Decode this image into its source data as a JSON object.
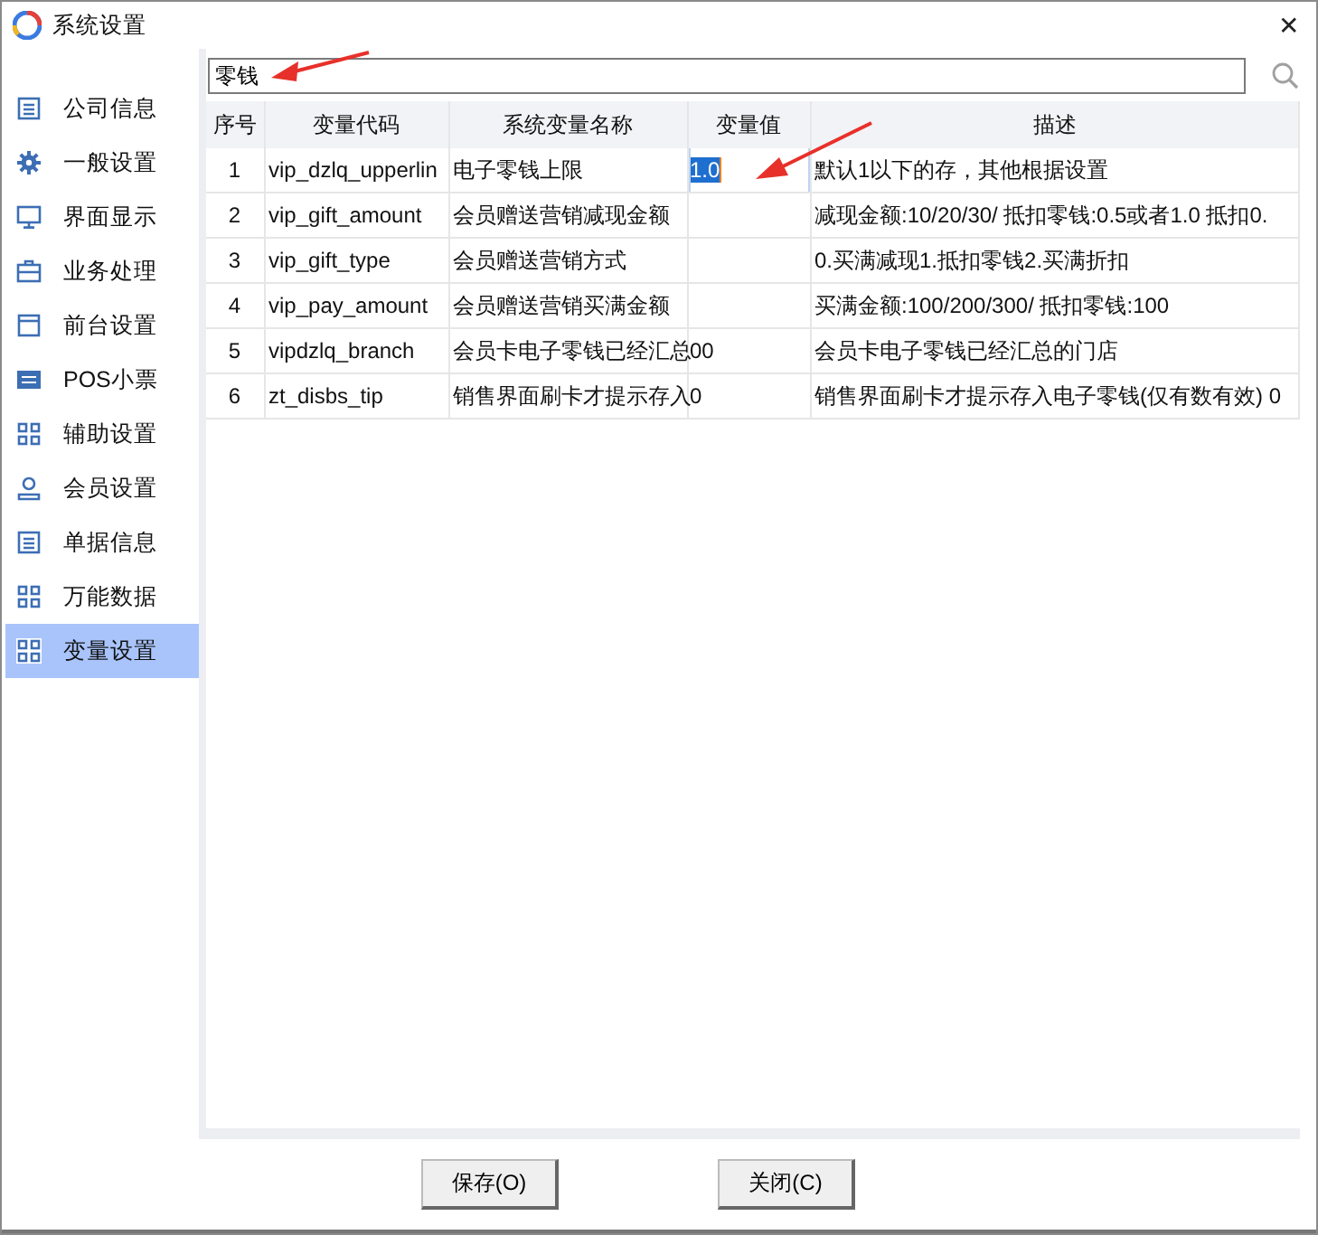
{
  "window": {
    "title": "系统设置",
    "close": "✕"
  },
  "sidebar": {
    "items": [
      {
        "label": "公司信息",
        "kind": "doc",
        "selected": false
      },
      {
        "label": "一般设置",
        "kind": "gear",
        "selected": false
      },
      {
        "label": "界面显示",
        "kind": "monitor",
        "selected": false
      },
      {
        "label": "业务处理",
        "kind": "case",
        "selected": false
      },
      {
        "label": "前台设置",
        "kind": "window",
        "selected": false
      },
      {
        "label": "POS小票",
        "kind": "ticket",
        "selected": false
      },
      {
        "label": "辅助设置",
        "kind": "grid",
        "selected": false
      },
      {
        "label": "会员设置",
        "kind": "person",
        "selected": false
      },
      {
        "label": "单据信息",
        "kind": "doc",
        "selected": false
      },
      {
        "label": "万能数据",
        "kind": "grid",
        "selected": false
      },
      {
        "label": "变量设置",
        "kind": "grid",
        "selected": true
      }
    ]
  },
  "search": {
    "value": "零钱"
  },
  "table": {
    "columns": [
      "序号",
      "变量代码",
      "系统变量名称",
      "变量值",
      "描述"
    ],
    "rows": [
      {
        "no": "1",
        "code": "vip_dzlq_upperlin",
        "name": "电子零钱上限",
        "value": "1.0",
        "value_selected": true,
        "desc": "默认1以下的存，其他根据设置"
      },
      {
        "no": "2",
        "code": "vip_gift_amount",
        "name": "会员赠送营销减现金额",
        "value": "",
        "value_selected": false,
        "desc": "减现金额:10/20/30/ 抵扣零钱:0.5或者1.0 抵扣0."
      },
      {
        "no": "3",
        "code": "vip_gift_type",
        "name": "会员赠送营销方式",
        "value": "",
        "value_selected": false,
        "desc": "0.买满减现1.抵扣零钱2.买满折扣"
      },
      {
        "no": "4",
        "code": "vip_pay_amount",
        "name": "会员赠送营销买满金额",
        "value": "",
        "value_selected": false,
        "desc": "买满金额:100/200/300/ 抵扣零钱:100"
      },
      {
        "no": "5",
        "code": "vipdzlq_branch",
        "name": "会员卡电子零钱已经汇总",
        "value": "00",
        "value_selected": false,
        "desc": "会员卡电子零钱已经汇总的门店"
      },
      {
        "no": "6",
        "code": "zt_disbs_tip",
        "name": "销售界面刷卡才提示存入",
        "value": "0",
        "value_selected": false,
        "desc": "销售界面刷卡才提示存入电子零钱(仅有数有效) 0"
      }
    ]
  },
  "buttons": [
    "保存(O)",
    "关闭(C)"
  ]
}
